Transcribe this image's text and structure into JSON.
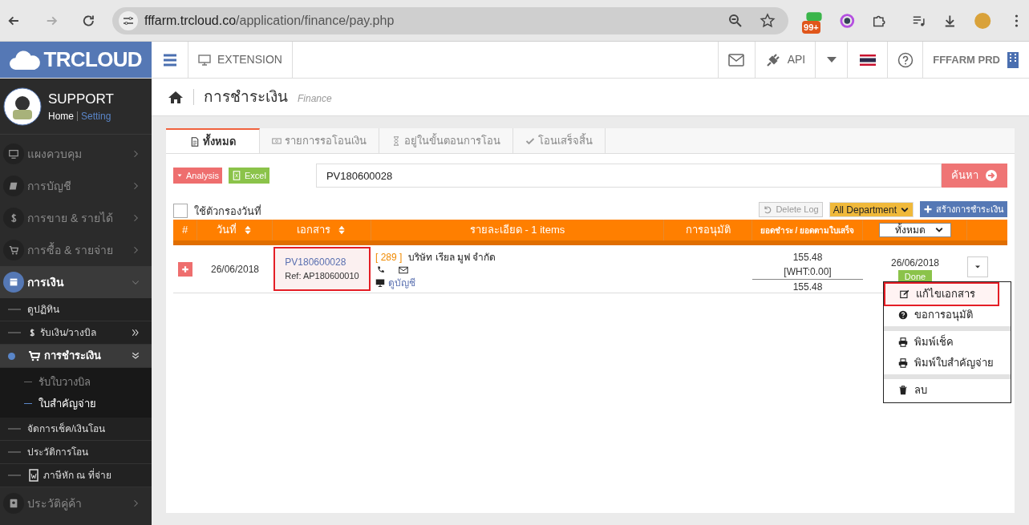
{
  "browser": {
    "url_host": "fffarm.trcloud.co",
    "url_path": "/application/finance/pay.php",
    "badge": "99+"
  },
  "header": {
    "logo": "TRCLOUD",
    "extension": "EXTENSION",
    "api": "API",
    "company": "FFFARM PRD"
  },
  "sidebar": {
    "user": "SUPPORT",
    "home": "Home",
    "setting": "Setting",
    "items": [
      {
        "label": "แผงควบคุม",
        "expanded": false,
        "selected": false
      },
      {
        "label": "การบัญชี",
        "expanded": false,
        "selected": false
      },
      {
        "label": "การขาย & รายได้",
        "expanded": false,
        "selected": false
      },
      {
        "label": "การซื้อ & รายจ่าย",
        "expanded": false,
        "selected": false
      },
      {
        "label": "การเงิน",
        "expanded": true,
        "selected": true,
        "children": [
          {
            "label": "ดูปฏิทิน",
            "selected": false
          },
          {
            "label": "รับเงิน/วางบิล",
            "selected": false,
            "expanded": false
          },
          {
            "label": "การชำระเงิน",
            "selected": true,
            "expanded": true,
            "children": [
              {
                "label": "รับใบวางบิล",
                "selected": false
              },
              {
                "label": "ใบสำคัญจ่าย",
                "selected": true
              }
            ]
          },
          {
            "label": "จัดการเช็ค/เงินโอน",
            "selected": false
          },
          {
            "label": "ประวัติการโอน",
            "selected": false
          },
          {
            "label": "ภาษีหัก ณ ที่จ่าย",
            "selected": false
          }
        ]
      },
      {
        "label": "ประวัติคู่ค้า",
        "expanded": false,
        "selected": false
      }
    ]
  },
  "page": {
    "title": "การชำระเงิน",
    "subtitle": "Finance"
  },
  "tabs": [
    {
      "label": "ทั้งหมด",
      "selected": true
    },
    {
      "label": "รายการรอโอนเงิน",
      "selected": false
    },
    {
      "label": "อยู่ในขั้นตอนการโอน",
      "selected": false
    },
    {
      "label": "โอนเสร็จสิ้น",
      "selected": false
    }
  ],
  "toolbar": {
    "analysis": "Analysis",
    "excel": "Excel",
    "search_value": "PV180600028",
    "search_button": "ค้นหา",
    "date_filter": {
      "label": "ใช้ตัวกรองวันที่",
      "checked": false
    },
    "delete_log": "Delete Log",
    "department": "All Department",
    "create": "สร้างการชำระเงิน"
  },
  "table": {
    "columns": [
      "#",
      "วันที่",
      "เอกสาร",
      "รายละเอียด - 1 items",
      "การอนุมัติ",
      "ยอดชำระ / ยอดตามใบเสร็จ"
    ],
    "status_filter": "ทั้งหมด",
    "rows": [
      {
        "date": "26/06/2018",
        "doc_no": "PV180600028",
        "ref": "Ref: AP180600010",
        "highlighted": true,
        "code": "[ 289 ]",
        "company": "บริษัท เรียล มูฟ จำกัด",
        "link": "ดูบัญชี",
        "amount": "155.48",
        "wht": "[WHT:0.00]",
        "receipt_amount": "155.48",
        "status_date": "26/06/2018",
        "status": "Done"
      }
    ]
  },
  "menu": {
    "groups": [
      {
        "items": [
          {
            "label": "แก้ไขเอกสาร",
            "highlighted": true
          },
          {
            "label": "ขอการอนุมัติ",
            "highlighted": false
          }
        ]
      },
      {
        "items": [
          {
            "label": "พิมพ์เช็ค",
            "highlighted": false
          },
          {
            "label": "พิมพ์ใบสำคัญจ่าย",
            "highlighted": false
          }
        ]
      },
      {
        "items": [
          {
            "label": "ลบ",
            "highlighted": false
          }
        ]
      }
    ]
  }
}
